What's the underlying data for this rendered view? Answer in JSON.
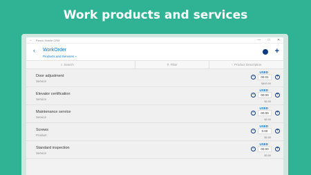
{
  "headline": "Work products and services",
  "window": {
    "title": "Resco Mobile CRM",
    "controls": [
      "—",
      "□",
      "✕"
    ]
  },
  "appbar": {
    "entity": "WorkOrder",
    "view": "Products and Services"
  },
  "searchbar": {
    "search_placeholder": "Search",
    "filter_label": "Filter",
    "sort_label": "Product Description"
  },
  "rows": [
    {
      "name": "Door adjustment",
      "type": "Service",
      "used": "USED",
      "qty": "00:01",
      "price": "$400.00"
    },
    {
      "name": "Elevator certification",
      "type": "Service",
      "used": "USED",
      "qty": "00:00",
      "price": "$0.00"
    },
    {
      "name": "Maintenance service",
      "type": "Service",
      "used": "USED",
      "qty": "00:00",
      "price": "$0.00"
    },
    {
      "name": "Screws",
      "type": "Product",
      "used": "USED",
      "qty": "0.00",
      "price": "$0.00"
    },
    {
      "name": "Standard inspection",
      "type": "Service",
      "used": "USED",
      "qty": "00:00",
      "price": "$0.00"
    }
  ]
}
